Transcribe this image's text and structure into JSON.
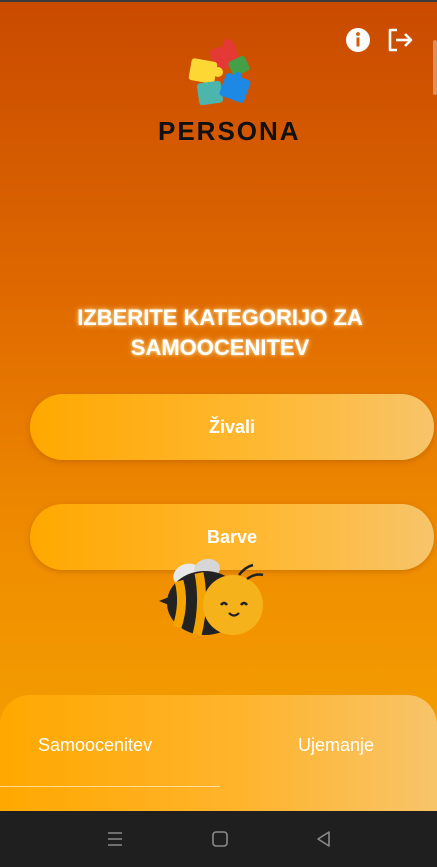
{
  "app": {
    "logo_text": "PERSONA"
  },
  "header": {
    "info_icon": "info-icon",
    "logout_icon": "logout-icon"
  },
  "main": {
    "heading": "IZBERITE KATEGORIJO ZA SAMOOCENITEV",
    "categories": [
      {
        "label": "Živali"
      },
      {
        "label": "Barve"
      }
    ]
  },
  "bottom_nav": {
    "tabs": [
      {
        "label": "Samoocenitev",
        "active": true
      },
      {
        "label": "Ujemanje",
        "active": false
      }
    ]
  },
  "system_nav": {
    "icons": [
      "recents-icon",
      "home-icon",
      "back-icon"
    ]
  },
  "colors": {
    "accent_orange": "#ffa800",
    "background_top": "#c94a00",
    "background_bottom": "#f7a700"
  }
}
